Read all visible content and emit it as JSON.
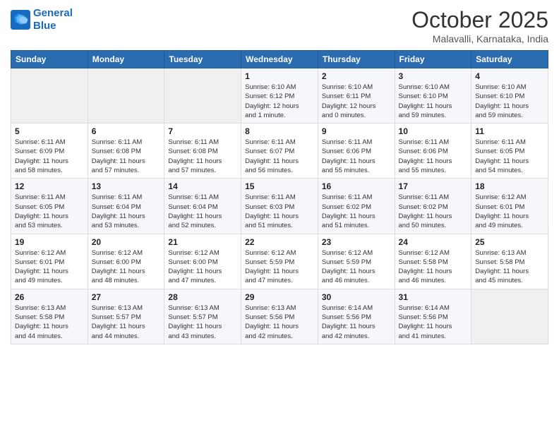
{
  "logo": {
    "line1": "General",
    "line2": "Blue"
  },
  "title": "October 2025",
  "location": "Malavalli, Karnataka, India",
  "days_of_week": [
    "Sunday",
    "Monday",
    "Tuesday",
    "Wednesday",
    "Thursday",
    "Friday",
    "Saturday"
  ],
  "weeks": [
    [
      {
        "day": "",
        "info": ""
      },
      {
        "day": "",
        "info": ""
      },
      {
        "day": "",
        "info": ""
      },
      {
        "day": "1",
        "info": "Sunrise: 6:10 AM\nSunset: 6:12 PM\nDaylight: 12 hours\nand 1 minute."
      },
      {
        "day": "2",
        "info": "Sunrise: 6:10 AM\nSunset: 6:11 PM\nDaylight: 12 hours\nand 0 minutes."
      },
      {
        "day": "3",
        "info": "Sunrise: 6:10 AM\nSunset: 6:10 PM\nDaylight: 11 hours\nand 59 minutes."
      },
      {
        "day": "4",
        "info": "Sunrise: 6:10 AM\nSunset: 6:10 PM\nDaylight: 11 hours\nand 59 minutes."
      }
    ],
    [
      {
        "day": "5",
        "info": "Sunrise: 6:11 AM\nSunset: 6:09 PM\nDaylight: 11 hours\nand 58 minutes."
      },
      {
        "day": "6",
        "info": "Sunrise: 6:11 AM\nSunset: 6:08 PM\nDaylight: 11 hours\nand 57 minutes."
      },
      {
        "day": "7",
        "info": "Sunrise: 6:11 AM\nSunset: 6:08 PM\nDaylight: 11 hours\nand 57 minutes."
      },
      {
        "day": "8",
        "info": "Sunrise: 6:11 AM\nSunset: 6:07 PM\nDaylight: 11 hours\nand 56 minutes."
      },
      {
        "day": "9",
        "info": "Sunrise: 6:11 AM\nSunset: 6:06 PM\nDaylight: 11 hours\nand 55 minutes."
      },
      {
        "day": "10",
        "info": "Sunrise: 6:11 AM\nSunset: 6:06 PM\nDaylight: 11 hours\nand 55 minutes."
      },
      {
        "day": "11",
        "info": "Sunrise: 6:11 AM\nSunset: 6:05 PM\nDaylight: 11 hours\nand 54 minutes."
      }
    ],
    [
      {
        "day": "12",
        "info": "Sunrise: 6:11 AM\nSunset: 6:05 PM\nDaylight: 11 hours\nand 53 minutes."
      },
      {
        "day": "13",
        "info": "Sunrise: 6:11 AM\nSunset: 6:04 PM\nDaylight: 11 hours\nand 53 minutes."
      },
      {
        "day": "14",
        "info": "Sunrise: 6:11 AM\nSunset: 6:04 PM\nDaylight: 11 hours\nand 52 minutes."
      },
      {
        "day": "15",
        "info": "Sunrise: 6:11 AM\nSunset: 6:03 PM\nDaylight: 11 hours\nand 51 minutes."
      },
      {
        "day": "16",
        "info": "Sunrise: 6:11 AM\nSunset: 6:02 PM\nDaylight: 11 hours\nand 51 minutes."
      },
      {
        "day": "17",
        "info": "Sunrise: 6:11 AM\nSunset: 6:02 PM\nDaylight: 11 hours\nand 50 minutes."
      },
      {
        "day": "18",
        "info": "Sunrise: 6:12 AM\nSunset: 6:01 PM\nDaylight: 11 hours\nand 49 minutes."
      }
    ],
    [
      {
        "day": "19",
        "info": "Sunrise: 6:12 AM\nSunset: 6:01 PM\nDaylight: 11 hours\nand 49 minutes."
      },
      {
        "day": "20",
        "info": "Sunrise: 6:12 AM\nSunset: 6:00 PM\nDaylight: 11 hours\nand 48 minutes."
      },
      {
        "day": "21",
        "info": "Sunrise: 6:12 AM\nSunset: 6:00 PM\nDaylight: 11 hours\nand 47 minutes."
      },
      {
        "day": "22",
        "info": "Sunrise: 6:12 AM\nSunset: 5:59 PM\nDaylight: 11 hours\nand 47 minutes."
      },
      {
        "day": "23",
        "info": "Sunrise: 6:12 AM\nSunset: 5:59 PM\nDaylight: 11 hours\nand 46 minutes."
      },
      {
        "day": "24",
        "info": "Sunrise: 6:12 AM\nSunset: 5:58 PM\nDaylight: 11 hours\nand 46 minutes."
      },
      {
        "day": "25",
        "info": "Sunrise: 6:13 AM\nSunset: 5:58 PM\nDaylight: 11 hours\nand 45 minutes."
      }
    ],
    [
      {
        "day": "26",
        "info": "Sunrise: 6:13 AM\nSunset: 5:58 PM\nDaylight: 11 hours\nand 44 minutes."
      },
      {
        "day": "27",
        "info": "Sunrise: 6:13 AM\nSunset: 5:57 PM\nDaylight: 11 hours\nand 44 minutes."
      },
      {
        "day": "28",
        "info": "Sunrise: 6:13 AM\nSunset: 5:57 PM\nDaylight: 11 hours\nand 43 minutes."
      },
      {
        "day": "29",
        "info": "Sunrise: 6:13 AM\nSunset: 5:56 PM\nDaylight: 11 hours\nand 42 minutes."
      },
      {
        "day": "30",
        "info": "Sunrise: 6:14 AM\nSunset: 5:56 PM\nDaylight: 11 hours\nand 42 minutes."
      },
      {
        "day": "31",
        "info": "Sunrise: 6:14 AM\nSunset: 5:56 PM\nDaylight: 11 hours\nand 41 minutes."
      },
      {
        "day": "",
        "info": ""
      }
    ]
  ]
}
